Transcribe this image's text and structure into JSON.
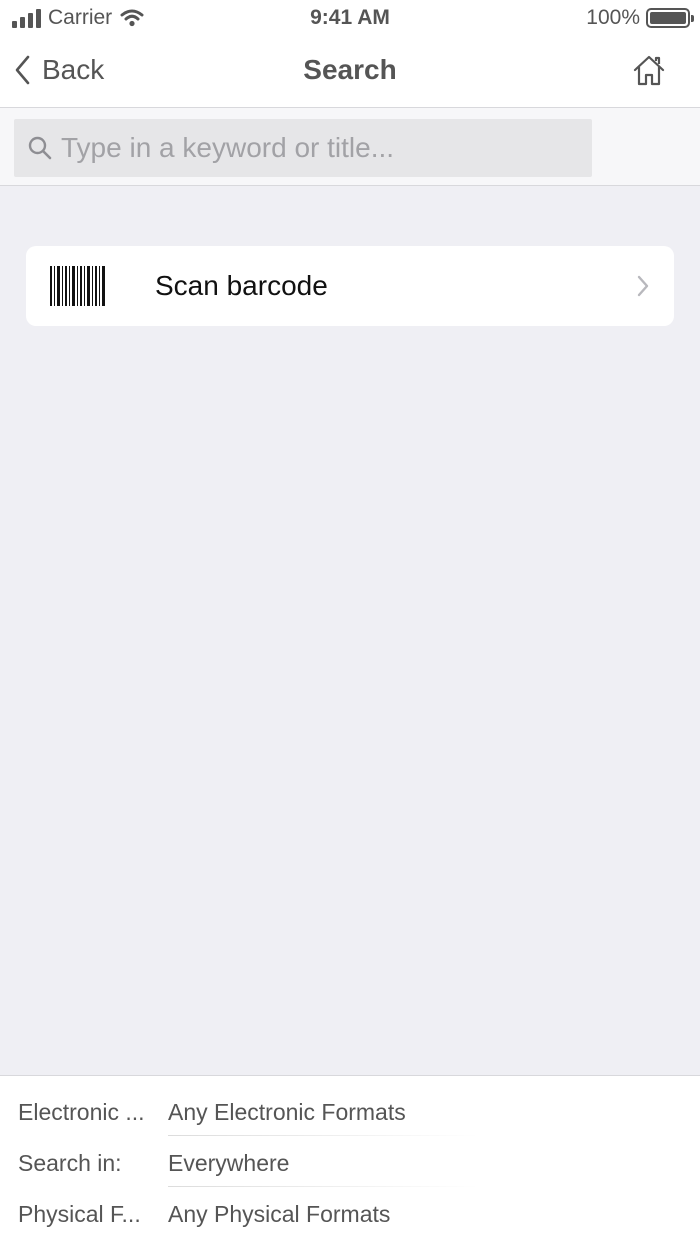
{
  "status_bar": {
    "carrier": "Carrier",
    "time": "9:41 AM",
    "battery": "100%"
  },
  "nav": {
    "back_label": "Back",
    "title": "Search"
  },
  "search": {
    "placeholder": "Type in a keyword or title..."
  },
  "scan": {
    "label": "Scan barcode"
  },
  "filters": [
    {
      "label": "Electronic ...",
      "value": "Any Electronic Formats"
    },
    {
      "label": "Search in:",
      "value": "Everywhere"
    },
    {
      "label": "Physical F...",
      "value": "Any Physical Formats"
    }
  ],
  "icons": {
    "back": "chevron-left-icon",
    "home": "home-icon",
    "search": "search-icon",
    "barcode": "barcode-icon",
    "disclosure": "chevron-right-icon"
  }
}
